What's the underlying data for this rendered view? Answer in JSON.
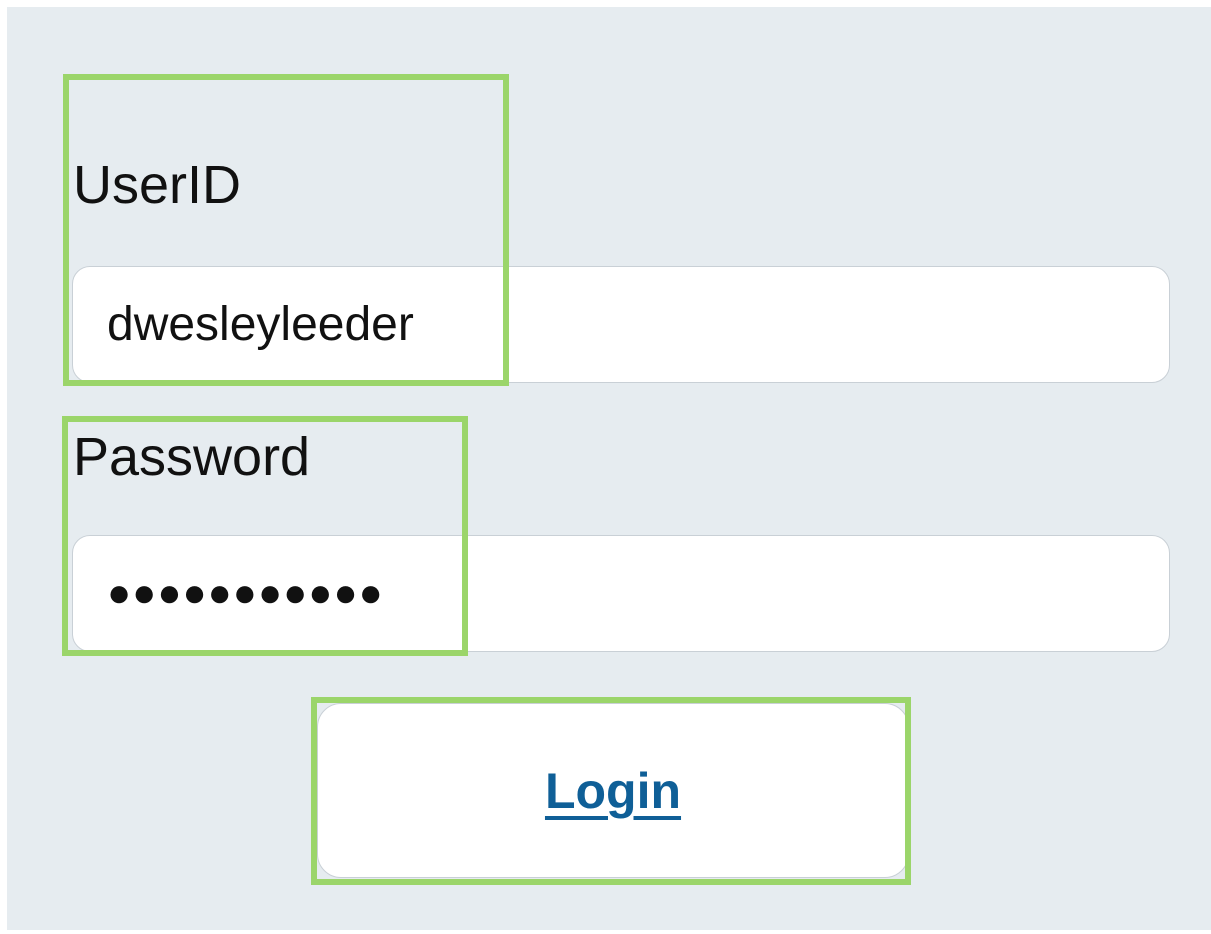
{
  "login_form": {
    "userid_label": "UserID",
    "userid_value": "dwesleyleeder",
    "password_label": "Password",
    "password_value": "●●●●●●●●●●●",
    "login_button_label": "Login"
  },
  "colors": {
    "background": "#e6ecf0",
    "highlight": "#9bd56a",
    "link": "#0f5f97"
  }
}
